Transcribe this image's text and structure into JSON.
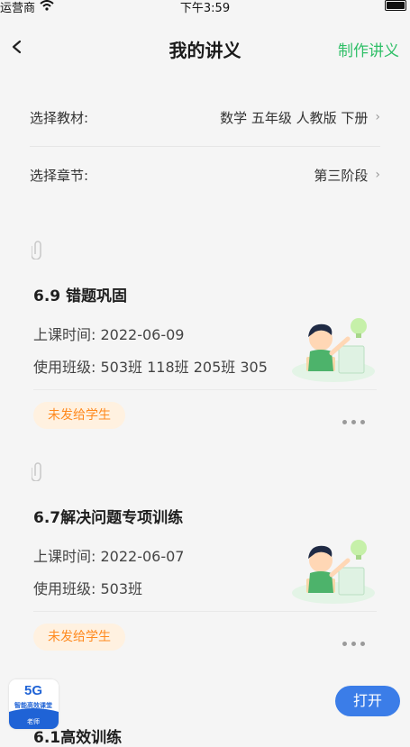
{
  "status_bar": {
    "carrier": "运营商",
    "time": "下午3:59"
  },
  "nav": {
    "title": "我的讲义",
    "make_label": "制作讲义"
  },
  "selectors": {
    "textbook": {
      "label": "选择教材:",
      "value": "数学 五年级 人教版 下册"
    },
    "chapter": {
      "label": "选择章节:",
      "value": "第三阶段"
    }
  },
  "notes": [
    {
      "title": "6.9 错题巩固",
      "time_label": "上课时间:",
      "time_value": "2022-06-09",
      "class_label": "使用班级:",
      "class_value": "503班 118班 205班 305",
      "status": "未发给学生"
    },
    {
      "title": "6.7解决问题专项训练",
      "time_label": "上课时间:",
      "time_value": "2022-06-07",
      "class_label": "使用班级:",
      "class_value": "503班",
      "status": "未发给学生"
    }
  ],
  "next_note": {
    "title": "6.1高效训练"
  },
  "promo": {
    "badge_top": "5G",
    "badge_sub": "智能高效课堂",
    "badge_role": "老师",
    "open_label": "打开"
  },
  "colors": {
    "accent_green": "#2fbf67",
    "pill_orange": "#ff8a1f",
    "open_blue": "#3b7de8"
  }
}
